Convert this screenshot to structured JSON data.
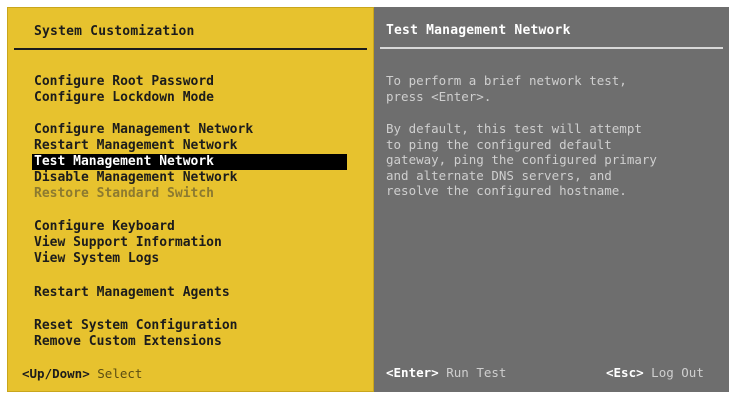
{
  "left": {
    "title": "System Customization",
    "menu": [
      {
        "label": "Configure Root Password",
        "state": "normal"
      },
      {
        "label": "Configure Lockdown Mode",
        "state": "normal"
      },
      {
        "label": "Configure Management Network",
        "state": "normal"
      },
      {
        "label": "Restart Management Network",
        "state": "normal"
      },
      {
        "label": "Test Management Network",
        "state": "selected"
      },
      {
        "label": "Disable Management Network",
        "state": "normal"
      },
      {
        "label": "Restore Standard Switch",
        "state": "disabled"
      },
      {
        "label": "Configure Keyboard",
        "state": "normal"
      },
      {
        "label": "View Support Information",
        "state": "normal"
      },
      {
        "label": "View System Logs",
        "state": "normal"
      },
      {
        "label": "Restart Management Agents",
        "state": "normal"
      },
      {
        "label": "Reset System Configuration",
        "state": "normal"
      },
      {
        "label": "Remove Custom Extensions",
        "state": "normal"
      }
    ],
    "footer": {
      "key": "<Up/Down>",
      "action": "Select"
    }
  },
  "right": {
    "title": "Test Management Network",
    "paragraph1": "To perform a brief network test,\npress <Enter>.",
    "paragraph2": "By default, this test will attempt\nto ping the configured default\ngateway, ping the configured primary\nand alternate DNS servers, and\nresolve the configured hostname.",
    "footer_left": {
      "key": "<Enter>",
      "action": "Run Test"
    },
    "footer_right": {
      "key": "<Esc>",
      "action": "Log Out"
    }
  },
  "colors": {
    "left_background": "#e7c22e",
    "right_background": "#6e6e6e",
    "selection_background": "#000000"
  }
}
